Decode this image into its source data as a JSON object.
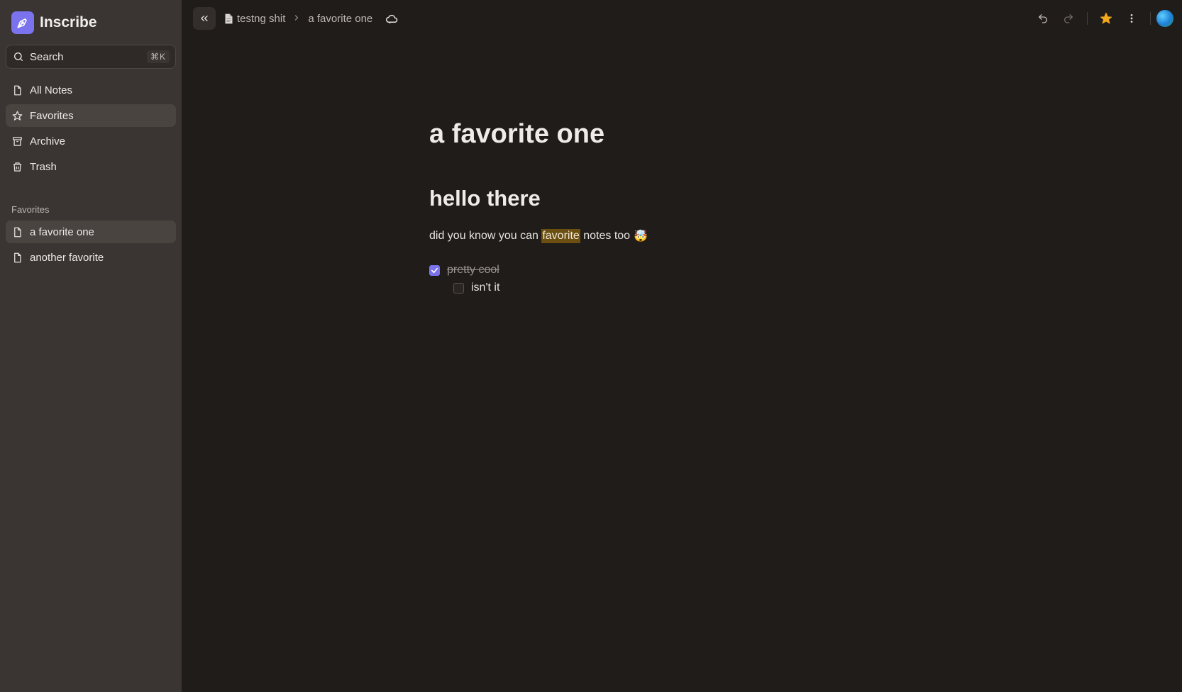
{
  "app": {
    "name": "Inscribe"
  },
  "search": {
    "label": "Search",
    "shortcut": "⌘K"
  },
  "nav": [
    {
      "label": "All Notes",
      "icon": "file-icon"
    },
    {
      "label": "Favorites",
      "icon": "star-icon",
      "active": true
    },
    {
      "label": "Archive",
      "icon": "archive-icon"
    },
    {
      "label": "Trash",
      "icon": "trash-icon"
    }
  ],
  "favorites": {
    "heading": "Favorites",
    "items": [
      {
        "label": "a favorite one",
        "active": true
      },
      {
        "label": "another favorite"
      }
    ]
  },
  "breadcrumb": {
    "parent": "testng shit",
    "current": "a favorite one"
  },
  "note": {
    "title": "a favorite one",
    "heading": "hello there",
    "paragraph": {
      "before": "did you know you can ",
      "highlight": "favorite",
      "after": " notes too",
      "emoji": "🤯"
    },
    "tasks": [
      {
        "text": "pretty cool",
        "checked": true
      },
      {
        "text": "isn't it",
        "checked": false
      }
    ]
  },
  "colors": {
    "accent": "#7b73ee",
    "sidebar_bg": "#3a3532",
    "main_bg": "#201c1a",
    "highlight_bg": "#6b4f10",
    "favorite_star": "#f2a91b"
  }
}
